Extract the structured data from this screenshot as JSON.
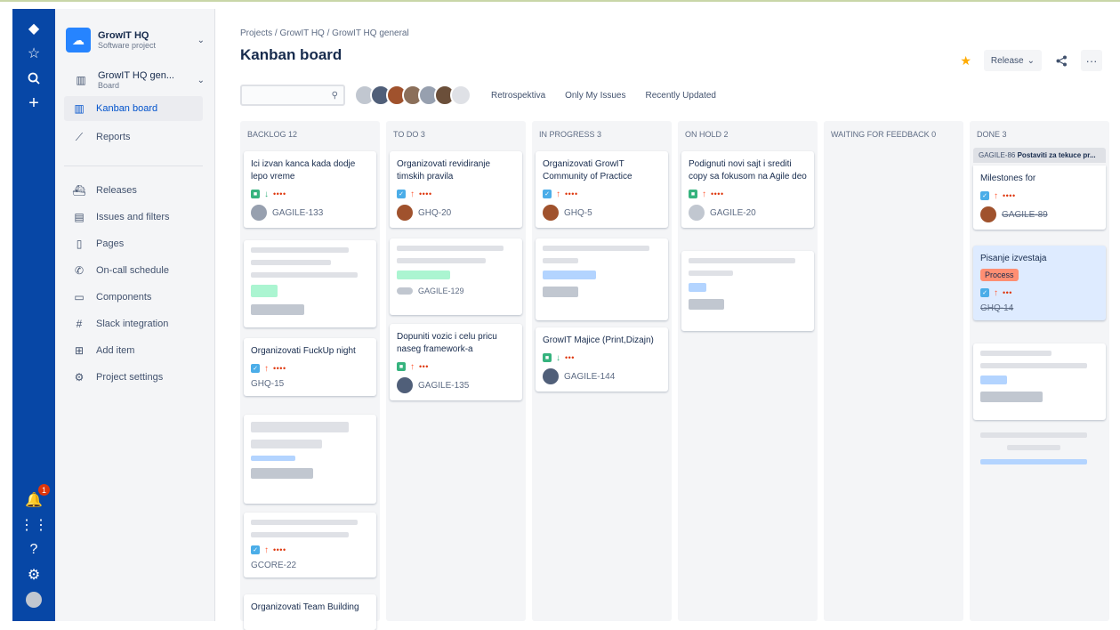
{
  "global_nav": {
    "notification_count": "1",
    "icons": [
      "jira-logo-icon",
      "star-icon",
      "search-icon",
      "create-icon",
      "notifications-icon",
      "app-switcher-icon",
      "help-icon",
      "settings-icon",
      "profile-avatar"
    ]
  },
  "sidebar": {
    "project_name": "GrowIT HQ",
    "project_type": "Software project",
    "board_name": "GrowIT HQ gen...",
    "board_label": "Board",
    "items": [
      {
        "label": "Kanban board",
        "icon": "board-icon"
      },
      {
        "label": "Reports",
        "icon": "chart-icon"
      },
      {
        "label": "Releases",
        "icon": "ship-icon"
      },
      {
        "label": "Issues and filters",
        "icon": "filter-icon"
      },
      {
        "label": "Pages",
        "icon": "page-icon"
      },
      {
        "label": "On-call schedule",
        "icon": "phone-icon"
      },
      {
        "label": "Components",
        "icon": "component-icon"
      },
      {
        "label": "Slack integration",
        "icon": "slack-icon"
      },
      {
        "label": "Add item",
        "icon": "add-item-icon"
      },
      {
        "label": "Project settings",
        "icon": "settings-icon"
      }
    ]
  },
  "header": {
    "breadcrumb": "Projects  /  GrowIT HQ  /  GrowIT HQ general",
    "title": "Kanban board",
    "release_label": "Release",
    "more_label": "···"
  },
  "filters": {
    "search_placeholder": "",
    "quick_filters": [
      "Retrospektiva",
      "Only My Issues",
      "Recently Updated"
    ]
  },
  "columns": [
    {
      "title": "BACKLOG 12"
    },
    {
      "title": "TO DO 3"
    },
    {
      "title": "IN PROGRESS 3"
    },
    {
      "title": "ON HOLD 2"
    },
    {
      "title": "WAITING FOR FEEDBACK 0"
    },
    {
      "title": "DONE 3"
    }
  ],
  "cards": {
    "backlog_1": {
      "summary": "Ici izvan kanca kada dodje lepo vreme",
      "key": "GAGILE-133"
    },
    "backlog_2": {
      "summary": "Organizovati FuckUp night",
      "key": "GHQ-15"
    },
    "backlog_3": {
      "key": "GCORE-22"
    },
    "backlog_4": {
      "summary": "Organizovati Team Building"
    },
    "todo_1": {
      "summary": "Organizovati revidiranje timskih pravila",
      "key": "GHQ-20"
    },
    "todo_2": {
      "key": "GAGILE-129"
    },
    "todo_3": {
      "summary": "Dopuniti vozic i celu pricu naseg framework-a",
      "key": "GAGILE-135"
    },
    "inprog_1": {
      "summary": "Organizovati GrowIT Community of Practice",
      "key": "GHQ-5"
    },
    "inprog_2": {
      "summary": "GrowIT Majice (Print,Dizajn)",
      "key": "GAGILE-144"
    },
    "hold_1": {
      "summary": "Podignuti novi sajt i srediti copy sa fokusom na Agile deo",
      "key": "GAGILE-20"
    },
    "done_banner": {
      "key": "GAGILE-86",
      "text": "Postaviti za tekuce pr..."
    },
    "done_1": {
      "summary": "Milestones for",
      "key": "GAGILE-89"
    },
    "done_2": {
      "summary": "Pisanje izvestaja",
      "label": "Process",
      "key": "GHQ-14"
    }
  },
  "colors": {
    "nav": "#0747a6",
    "accent": "#0052cc",
    "column": "#f4f5f7",
    "story": "#36b37e",
    "task": "#4bade8",
    "priority_high": "#ff5630"
  }
}
